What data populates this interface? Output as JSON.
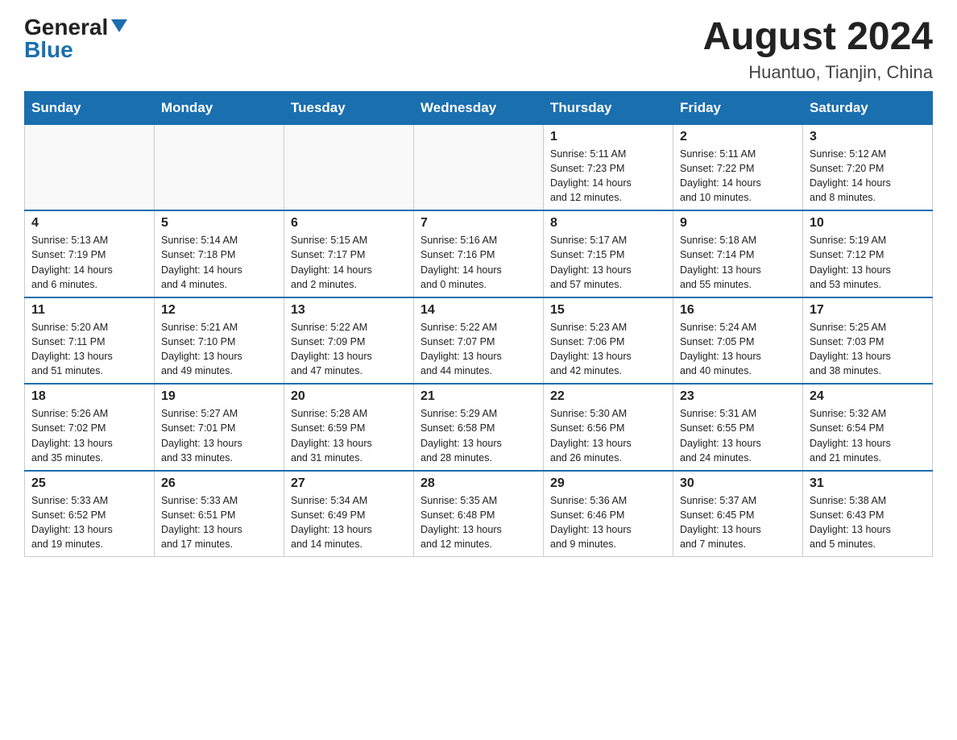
{
  "header": {
    "logo_general": "General",
    "logo_blue": "Blue",
    "month_year": "August 2024",
    "location": "Huantuo, Tianjin, China"
  },
  "days_of_week": [
    "Sunday",
    "Monday",
    "Tuesday",
    "Wednesday",
    "Thursday",
    "Friday",
    "Saturday"
  ],
  "weeks": [
    [
      {
        "day": "",
        "info": ""
      },
      {
        "day": "",
        "info": ""
      },
      {
        "day": "",
        "info": ""
      },
      {
        "day": "",
        "info": ""
      },
      {
        "day": "1",
        "info": "Sunrise: 5:11 AM\nSunset: 7:23 PM\nDaylight: 14 hours\nand 12 minutes."
      },
      {
        "day": "2",
        "info": "Sunrise: 5:11 AM\nSunset: 7:22 PM\nDaylight: 14 hours\nand 10 minutes."
      },
      {
        "day": "3",
        "info": "Sunrise: 5:12 AM\nSunset: 7:20 PM\nDaylight: 14 hours\nand 8 minutes."
      }
    ],
    [
      {
        "day": "4",
        "info": "Sunrise: 5:13 AM\nSunset: 7:19 PM\nDaylight: 14 hours\nand 6 minutes."
      },
      {
        "day": "5",
        "info": "Sunrise: 5:14 AM\nSunset: 7:18 PM\nDaylight: 14 hours\nand 4 minutes."
      },
      {
        "day": "6",
        "info": "Sunrise: 5:15 AM\nSunset: 7:17 PM\nDaylight: 14 hours\nand 2 minutes."
      },
      {
        "day": "7",
        "info": "Sunrise: 5:16 AM\nSunset: 7:16 PM\nDaylight: 14 hours\nand 0 minutes."
      },
      {
        "day": "8",
        "info": "Sunrise: 5:17 AM\nSunset: 7:15 PM\nDaylight: 13 hours\nand 57 minutes."
      },
      {
        "day": "9",
        "info": "Sunrise: 5:18 AM\nSunset: 7:14 PM\nDaylight: 13 hours\nand 55 minutes."
      },
      {
        "day": "10",
        "info": "Sunrise: 5:19 AM\nSunset: 7:12 PM\nDaylight: 13 hours\nand 53 minutes."
      }
    ],
    [
      {
        "day": "11",
        "info": "Sunrise: 5:20 AM\nSunset: 7:11 PM\nDaylight: 13 hours\nand 51 minutes."
      },
      {
        "day": "12",
        "info": "Sunrise: 5:21 AM\nSunset: 7:10 PM\nDaylight: 13 hours\nand 49 minutes."
      },
      {
        "day": "13",
        "info": "Sunrise: 5:22 AM\nSunset: 7:09 PM\nDaylight: 13 hours\nand 47 minutes."
      },
      {
        "day": "14",
        "info": "Sunrise: 5:22 AM\nSunset: 7:07 PM\nDaylight: 13 hours\nand 44 minutes."
      },
      {
        "day": "15",
        "info": "Sunrise: 5:23 AM\nSunset: 7:06 PM\nDaylight: 13 hours\nand 42 minutes."
      },
      {
        "day": "16",
        "info": "Sunrise: 5:24 AM\nSunset: 7:05 PM\nDaylight: 13 hours\nand 40 minutes."
      },
      {
        "day": "17",
        "info": "Sunrise: 5:25 AM\nSunset: 7:03 PM\nDaylight: 13 hours\nand 38 minutes."
      }
    ],
    [
      {
        "day": "18",
        "info": "Sunrise: 5:26 AM\nSunset: 7:02 PM\nDaylight: 13 hours\nand 35 minutes."
      },
      {
        "day": "19",
        "info": "Sunrise: 5:27 AM\nSunset: 7:01 PM\nDaylight: 13 hours\nand 33 minutes."
      },
      {
        "day": "20",
        "info": "Sunrise: 5:28 AM\nSunset: 6:59 PM\nDaylight: 13 hours\nand 31 minutes."
      },
      {
        "day": "21",
        "info": "Sunrise: 5:29 AM\nSunset: 6:58 PM\nDaylight: 13 hours\nand 28 minutes."
      },
      {
        "day": "22",
        "info": "Sunrise: 5:30 AM\nSunset: 6:56 PM\nDaylight: 13 hours\nand 26 minutes."
      },
      {
        "day": "23",
        "info": "Sunrise: 5:31 AM\nSunset: 6:55 PM\nDaylight: 13 hours\nand 24 minutes."
      },
      {
        "day": "24",
        "info": "Sunrise: 5:32 AM\nSunset: 6:54 PM\nDaylight: 13 hours\nand 21 minutes."
      }
    ],
    [
      {
        "day": "25",
        "info": "Sunrise: 5:33 AM\nSunset: 6:52 PM\nDaylight: 13 hours\nand 19 minutes."
      },
      {
        "day": "26",
        "info": "Sunrise: 5:33 AM\nSunset: 6:51 PM\nDaylight: 13 hours\nand 17 minutes."
      },
      {
        "day": "27",
        "info": "Sunrise: 5:34 AM\nSunset: 6:49 PM\nDaylight: 13 hours\nand 14 minutes."
      },
      {
        "day": "28",
        "info": "Sunrise: 5:35 AM\nSunset: 6:48 PM\nDaylight: 13 hours\nand 12 minutes."
      },
      {
        "day": "29",
        "info": "Sunrise: 5:36 AM\nSunset: 6:46 PM\nDaylight: 13 hours\nand 9 minutes."
      },
      {
        "day": "30",
        "info": "Sunrise: 5:37 AM\nSunset: 6:45 PM\nDaylight: 13 hours\nand 7 minutes."
      },
      {
        "day": "31",
        "info": "Sunrise: 5:38 AM\nSunset: 6:43 PM\nDaylight: 13 hours\nand 5 minutes."
      }
    ]
  ]
}
